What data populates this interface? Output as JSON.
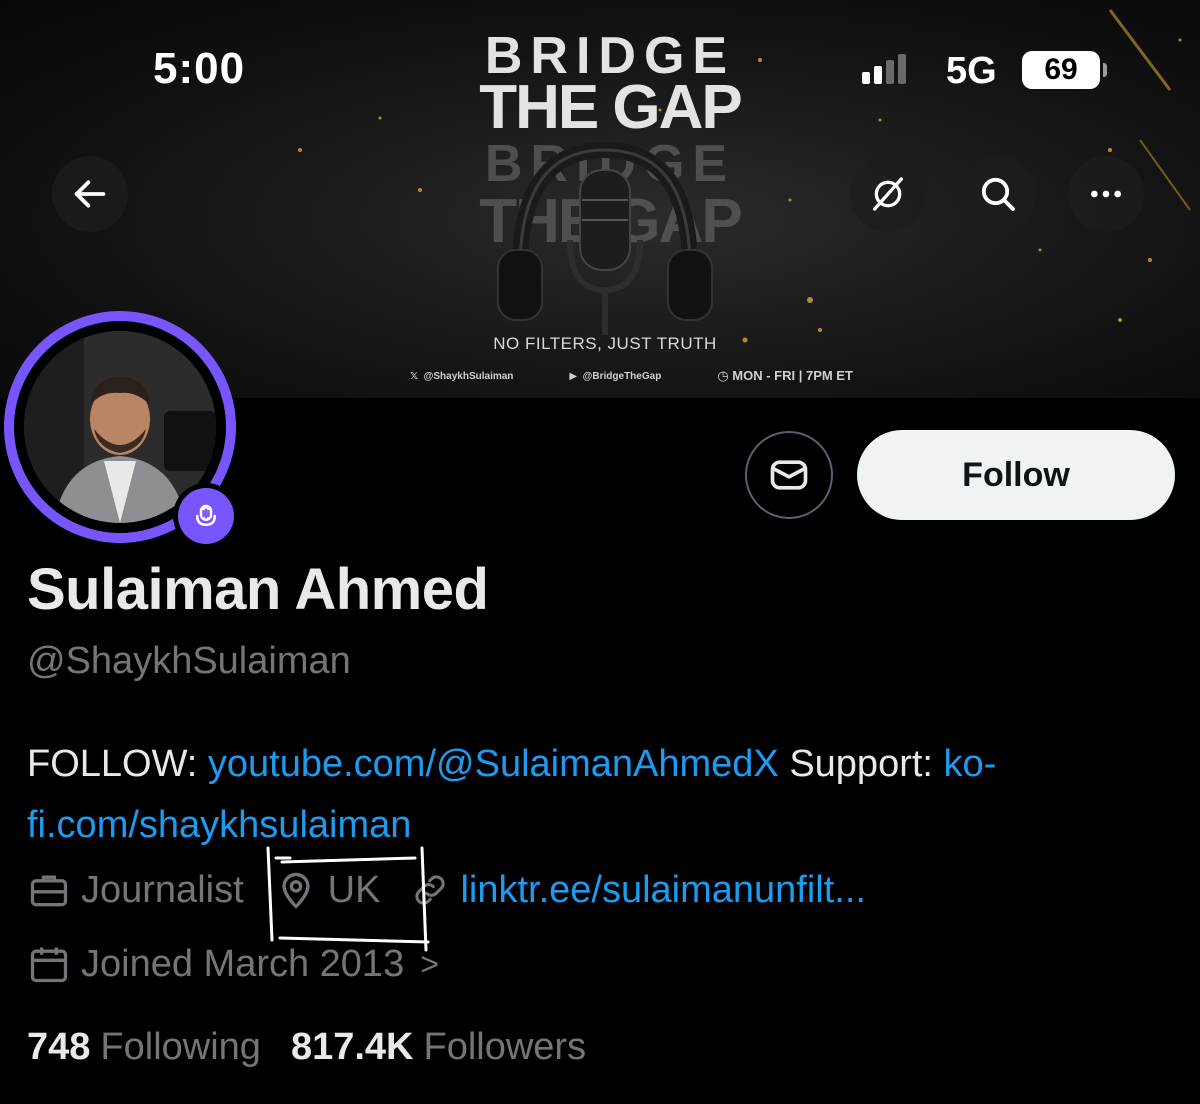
{
  "status_bar": {
    "time": "5:00",
    "network": "5G",
    "battery": "69"
  },
  "banner": {
    "title_line1": "BRIDGE",
    "title_line2": "THE GAP",
    "tagline": "NO FILTERS, JUST TRUTH",
    "credit_x": "@ShaykhSulaiman",
    "credit_rumble": "@BridgeTheGap",
    "schedule": "MON - FRI | 7PM ET"
  },
  "nav": {
    "back_icon": "arrow-left-icon",
    "grok_icon": "grok-icon",
    "search_icon": "search-icon",
    "more_icon": "more-horizontal-icon"
  },
  "actions": {
    "message_icon": "envelope-icon",
    "follow_label": "Follow"
  },
  "profile": {
    "name": "Sulaiman Ahmed",
    "handle": "@ShaykhSulaiman",
    "bio_prefix": "FOLLOW: ",
    "bio_link1": "youtube.com/@SulaimanAhmedX",
    "bio_middle": " Support: ",
    "bio_link2": "ko-fi.com/shaykhsulaiman",
    "profession": "Journalist",
    "location": "UK",
    "website": "linktr.ee/sulaimanunfilt...",
    "joined": "Joined March 2013",
    "joined_chevron": ">"
  },
  "stats": {
    "following_count": "748",
    "following_label": "Following",
    "followers_count": "817.4K",
    "followers_label": "Followers"
  },
  "colors": {
    "accent_blue": "#1d9bf0",
    "ring_purple": "#7856ff",
    "muted_gray": "#71767b"
  }
}
